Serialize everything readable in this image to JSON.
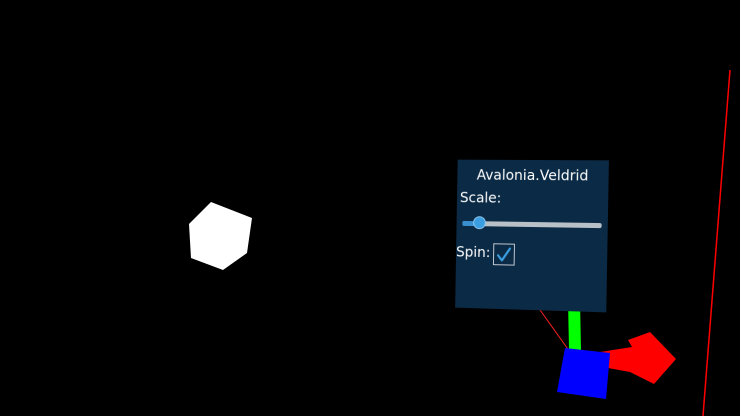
{
  "panel": {
    "title": "Avalonia.Veldrid",
    "scale_label": "Scale:",
    "scale_value": 0.12,
    "spin_label": "Spin:",
    "spin_checked": true
  },
  "colors": {
    "background": "#000000",
    "panel_bg": "#0b2a45",
    "cube": "#ffffff",
    "gizmo_x": "#ff0000",
    "gizmo_y": "#00ff00",
    "gizmo_z": "#0000ff",
    "slider_accent": "#3b9ee0"
  },
  "scene": {
    "objects": [
      "white-cube",
      "transform-gizmo",
      "floating-ui-panel",
      "red-boundary-line"
    ]
  }
}
